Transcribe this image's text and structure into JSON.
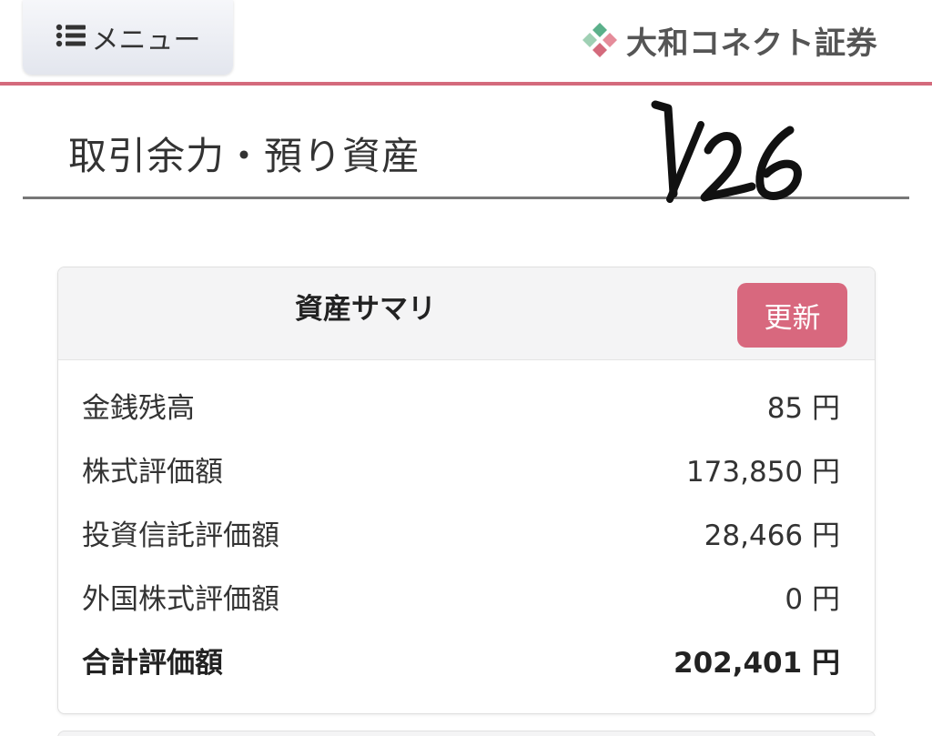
{
  "header": {
    "menu_label": "メニュー",
    "brand_name": "大和コネクト証券",
    "accent_color": "#d46a7c"
  },
  "page": {
    "title": "取引余力・預り資産",
    "annotation": "1/26"
  },
  "summary": {
    "title": "資産サマリ",
    "refresh_label": "更新",
    "rows": [
      {
        "label": "金銭残高",
        "value": "85 円"
      },
      {
        "label": "株式評価額",
        "value": "173,850 円"
      },
      {
        "label": "投資信託評価額",
        "value": "28,466 円"
      },
      {
        "label": "外国株式評価額",
        "value": "0 円"
      }
    ],
    "total": {
      "label": "合計評価額",
      "value": "202,401 円"
    }
  },
  "icons": {
    "menu": "list-icon",
    "brand": "brand-logo-icon"
  }
}
